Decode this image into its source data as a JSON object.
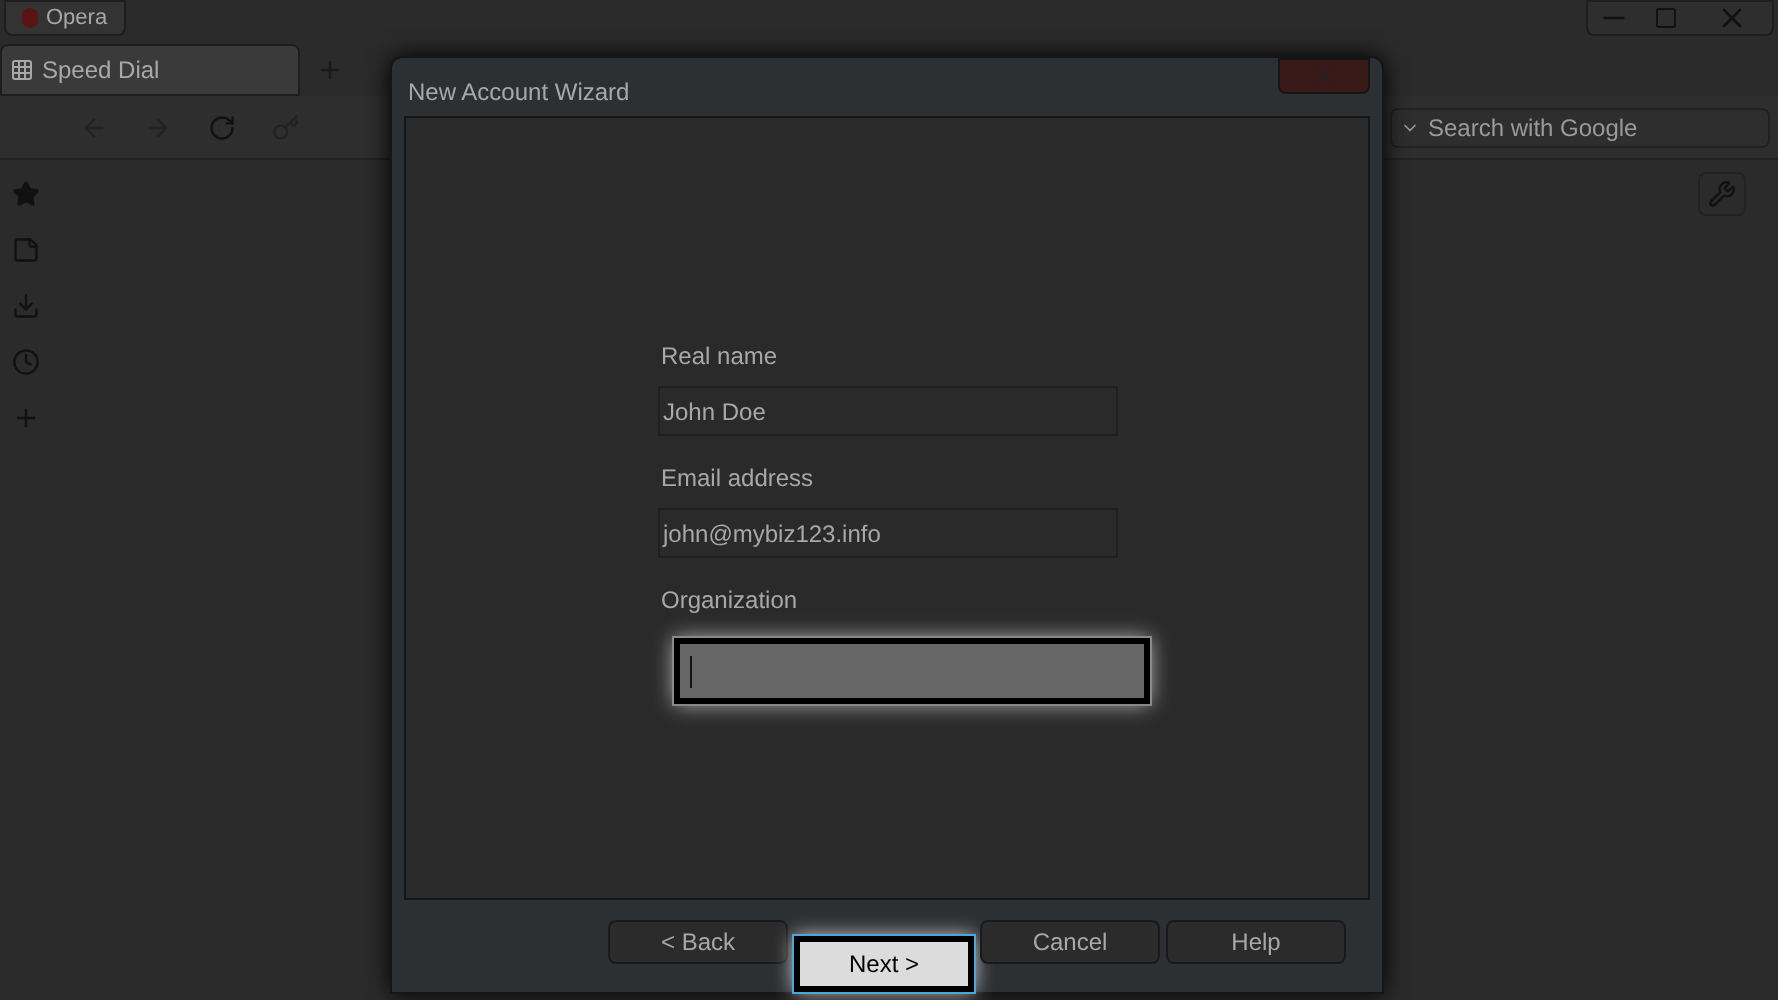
{
  "browser": {
    "menu_button": "Opera",
    "tabs": [
      {
        "label": "Speed Dial",
        "selected": true
      }
    ],
    "search": {
      "placeholder": "Search with Google"
    }
  },
  "dialog": {
    "title": "New Account Wizard",
    "fields": [
      {
        "label": "Real name",
        "value": "John Doe",
        "highlighted": false
      },
      {
        "label": "Email address",
        "value": "john@mybiz123.info",
        "highlighted": false
      },
      {
        "label": "Organization",
        "highlighted": true
      }
    ],
    "buttons": [
      {
        "label": "< Back",
        "highlighted": false
      },
      {
        "label": "Next >",
        "highlighted": true
      },
      {
        "label": "Cancel",
        "highlighted": false
      },
      {
        "label": "Help",
        "highlighted": false
      }
    ]
  }
}
